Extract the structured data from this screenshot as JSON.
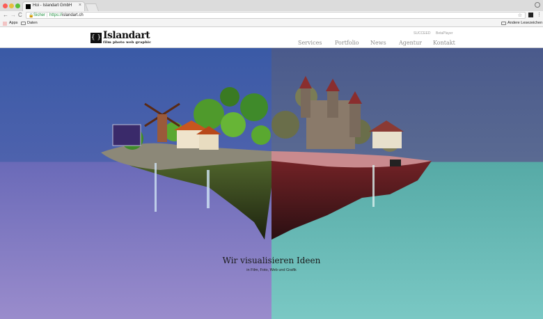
{
  "browser": {
    "tab_title": "Hoi - Islandart GmbH",
    "tab_close": "×",
    "nav_back": "←",
    "nav_forward": "→",
    "nav_reload": "C",
    "secure_label": "Sicher",
    "url_scheme": "https://",
    "url_host": "islandart.ch",
    "bookmarks": [
      {
        "label": "Apps",
        "icon": "apps-grid-icon"
      },
      {
        "label": "Daten",
        "icon": "folder-icon"
      }
    ],
    "other_bookmarks": "Andere Lesezeichen"
  },
  "site": {
    "logo_word": "Islandart",
    "logo_tagline": "film photo web graphic",
    "top_links": [
      "SUCCEED",
      "BetaPlayer"
    ],
    "nav": [
      "Services",
      "Portfolio",
      "News",
      "Agentur",
      "Kontakt"
    ]
  },
  "hero": {
    "title": "Wir visualisieren Ideen",
    "subtitle": "in Film, Foto, Web und Grafik"
  },
  "colors": {
    "sky_left_top": "#3a5aa6",
    "sky_left_bottom": "#9a8ccc",
    "sky_right_top": "#4a5a8c",
    "sky_right_bottom": "#7ac8c4",
    "island_green": "#4f9a2c",
    "island_red": "#7a2428"
  }
}
